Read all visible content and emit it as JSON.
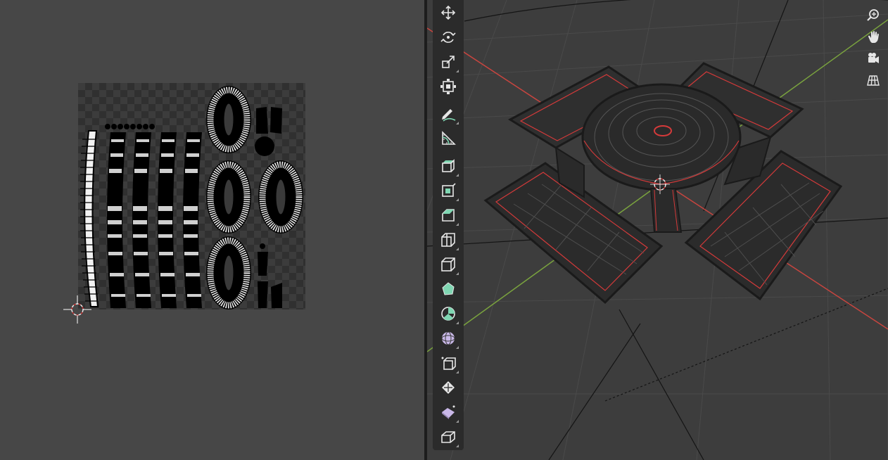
{
  "uv_editor": {
    "background": "#474747",
    "checker_dark": "#303030",
    "checker_light": "#3c3c3c"
  },
  "viewport": {
    "background": "#3d3d3d",
    "x_axis_color": "#c8453f",
    "y_axis_color": "#7aa33e",
    "edge_color": "#1a1a1a",
    "seam_color": "#d43a3a",
    "tools": [
      {
        "name": "move",
        "icon": "move-icon"
      },
      {
        "name": "rotate",
        "icon": "rotate-icon"
      },
      {
        "name": "scale",
        "icon": "scale-icon"
      },
      {
        "name": "transform",
        "icon": "transform-icon"
      },
      {
        "name": "annotate",
        "icon": "annotate-icon"
      },
      {
        "name": "measure",
        "icon": "measure-icon"
      },
      {
        "name": "add-cube",
        "icon": "add-cube-icon"
      },
      {
        "name": "extrude-region",
        "icon": "extrude-icon"
      },
      {
        "name": "inset-faces",
        "icon": "inset-icon"
      },
      {
        "name": "bevel",
        "icon": "bevel-icon"
      },
      {
        "name": "loop-cut",
        "icon": "loop-cut-icon"
      },
      {
        "name": "knife",
        "icon": "knife-icon"
      },
      {
        "name": "poly-build",
        "icon": "poly-build-icon"
      },
      {
        "name": "spin",
        "icon": "spin-icon"
      },
      {
        "name": "smooth",
        "icon": "smooth-icon"
      },
      {
        "name": "edge-slide",
        "icon": "edge-slide-icon"
      },
      {
        "name": "shrink-fatten",
        "icon": "shrink-fatten-icon"
      },
      {
        "name": "shear",
        "icon": "shear-icon"
      },
      {
        "name": "rip-region",
        "icon": "rip-icon"
      }
    ],
    "navigation": [
      {
        "name": "zoom",
        "icon": "zoom-icon"
      },
      {
        "name": "pan",
        "icon": "hand-icon"
      },
      {
        "name": "camera",
        "icon": "camera-icon"
      },
      {
        "name": "ortho-toggle",
        "icon": "grid-icon"
      }
    ]
  }
}
